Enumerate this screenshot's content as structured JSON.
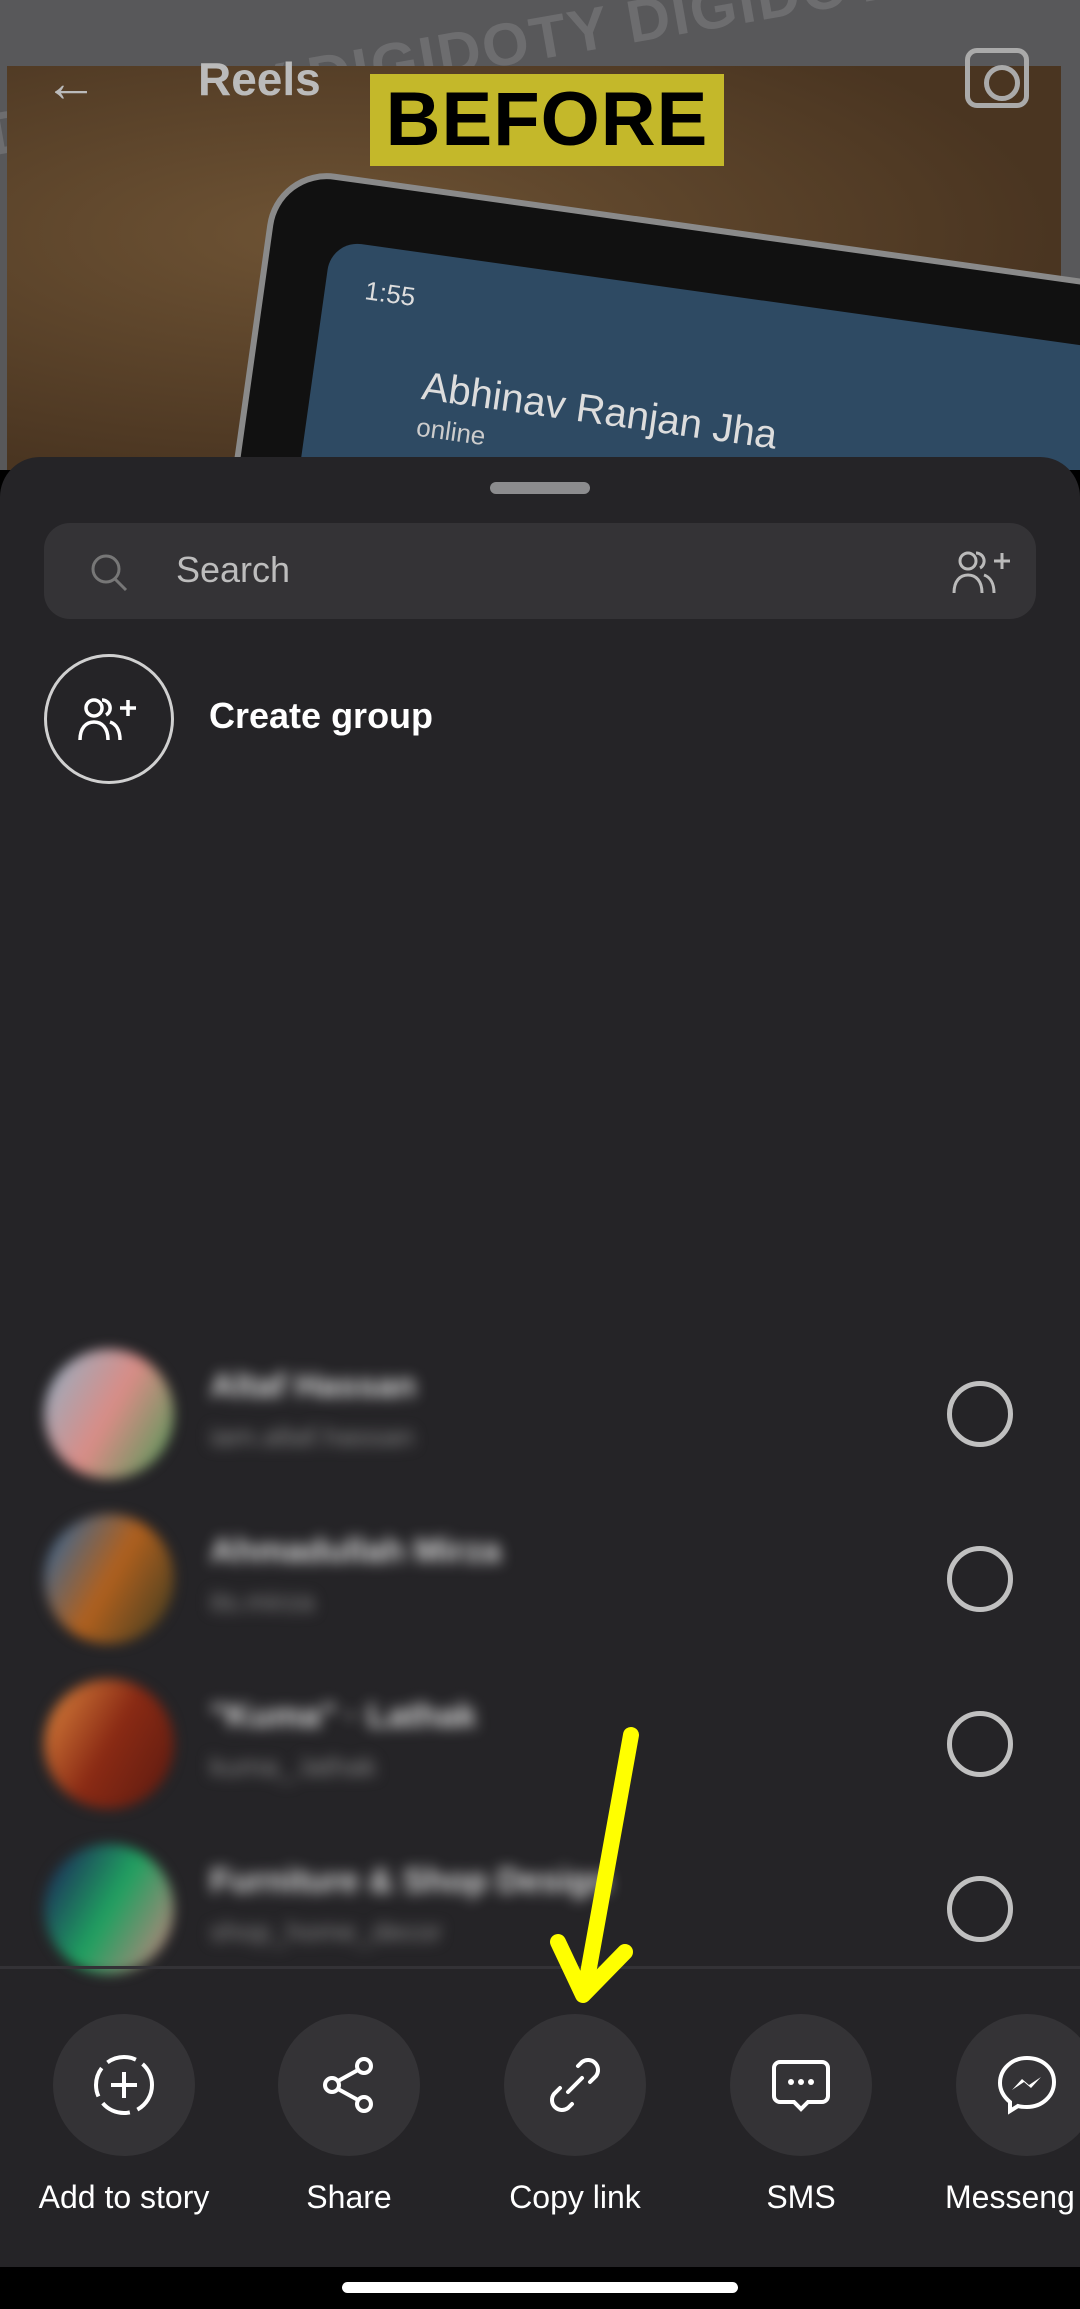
{
  "background": {
    "watermark": "DIGIDOTY DIGIDOTY DIGIDOTY DIGIDOTY",
    "title": "Reels",
    "overlay_label": "BEFORE",
    "phone_time": "1:55",
    "phone_contact_name": "Abhinav Ranjan Jha",
    "phone_contact_status": "online"
  },
  "sheet": {
    "search": {
      "placeholder": "Search"
    },
    "create_group": "Create group",
    "contacts": [
      {
        "name": "Altaf Hassan",
        "handle": "iam.altaf.hassan",
        "selected": false,
        "avatar_colors": [
          "#8fb3c9",
          "#d98c86",
          "#4a9a55"
        ]
      },
      {
        "name": "Ahmadullah Mirza",
        "handle": "its.mirza",
        "selected": false,
        "avatar_colors": [
          "#2a6aa8",
          "#b0601e",
          "#3a3a20"
        ]
      },
      {
        "name": "\"Kuma\" · Lathak",
        "handle": "kuma_.lathak",
        "selected": false,
        "avatar_colors": [
          "#e08a40",
          "#8a2a14",
          "#5a1a10"
        ]
      },
      {
        "name": "Furniture & Shop Design",
        "handle": "shop_home_decor",
        "selected": false,
        "avatar_colors": [
          "#1a1a5a",
          "#20a060",
          "#d08080"
        ]
      }
    ],
    "actions": [
      {
        "label": "Add to story",
        "icon": "add-story-icon"
      },
      {
        "label": "Share",
        "icon": "share-icon"
      },
      {
        "label": "Copy link",
        "icon": "link-icon"
      },
      {
        "label": "SMS",
        "icon": "sms-icon"
      },
      {
        "label": "Messeng",
        "icon": "messenger-icon"
      }
    ]
  },
  "annotation": {
    "arrow_color": "#ffff00"
  }
}
